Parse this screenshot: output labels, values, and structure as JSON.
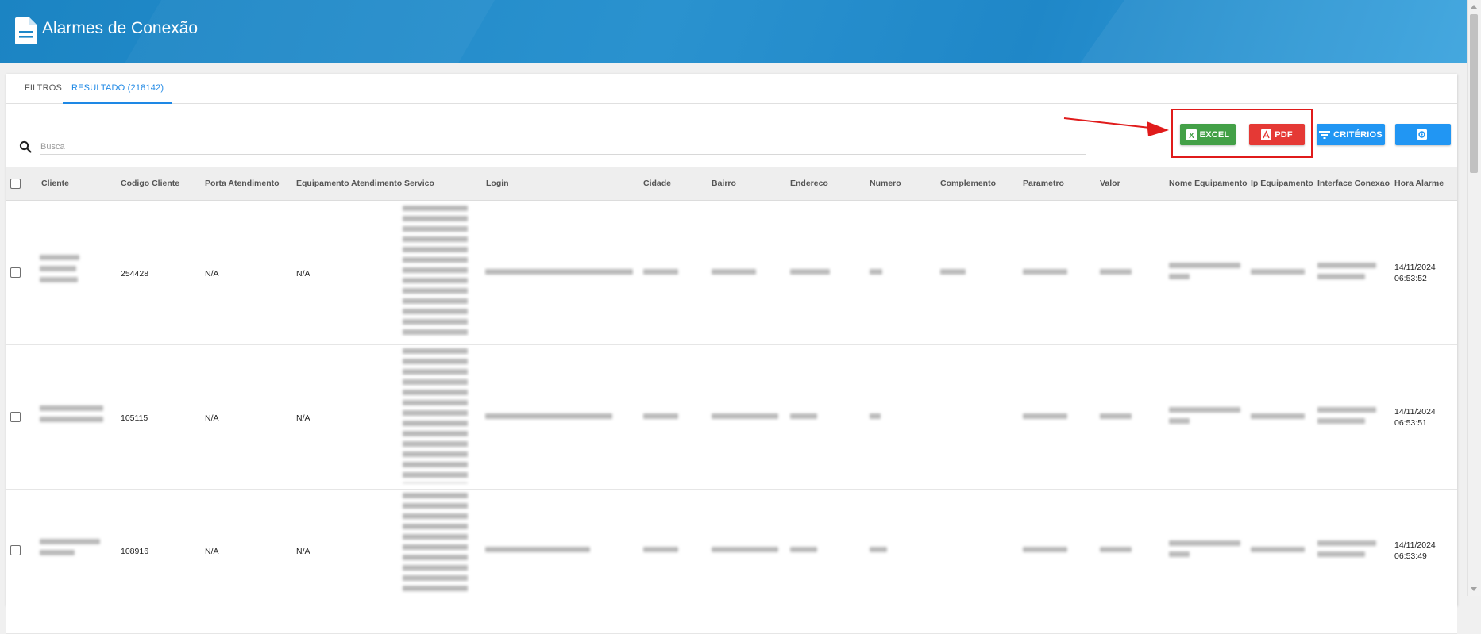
{
  "header": {
    "title": "Alarmes de Conexão"
  },
  "tabs": [
    {
      "label": "FILTROS",
      "active": false
    },
    {
      "label": "RESULTADO (218142)",
      "active": true
    }
  ],
  "search": {
    "placeholder": "Busca",
    "value": ""
  },
  "toolbar": {
    "excel_label": "EXCEL",
    "pdf_label": "PDF",
    "criterios_label": "CRITÉRIOS",
    "settings_icon": "gear-icon"
  },
  "table": {
    "columns": [
      "Cliente",
      "Codigo Cliente",
      "Porta Atendimento",
      "Equipamento Atendimento",
      "Servico",
      "Login",
      "Cidade",
      "Bairro",
      "Endereco",
      "Numero",
      "Complemento",
      "Parametro",
      "Valor",
      "Nome Equipamento",
      "Ip Equipamento",
      "Interface Conexao",
      "Hora Alarme"
    ],
    "rows": [
      {
        "codigo_cliente": "254428",
        "porta_atendimento": "N/A",
        "equipamento_atendimento": "N/A",
        "hora_alarme_date": "14/11/2024",
        "hora_alarme_time": "06:53:52"
      },
      {
        "codigo_cliente": "105115",
        "porta_atendimento": "N/A",
        "equipamento_atendimento": "N/A",
        "hora_alarme_date": "14/11/2024",
        "hora_alarme_time": "06:53:51"
      },
      {
        "codigo_cliente": "108916",
        "porta_atendimento": "N/A",
        "equipamento_atendimento": "N/A",
        "hora_alarme_date": "14/11/2024",
        "hora_alarme_time": "06:53:49"
      }
    ]
  },
  "colors": {
    "header": "#1f87c8",
    "excel": "#43a047",
    "pdf": "#e53935",
    "primary": "#2196f3",
    "annotation": "#e01b1b"
  }
}
